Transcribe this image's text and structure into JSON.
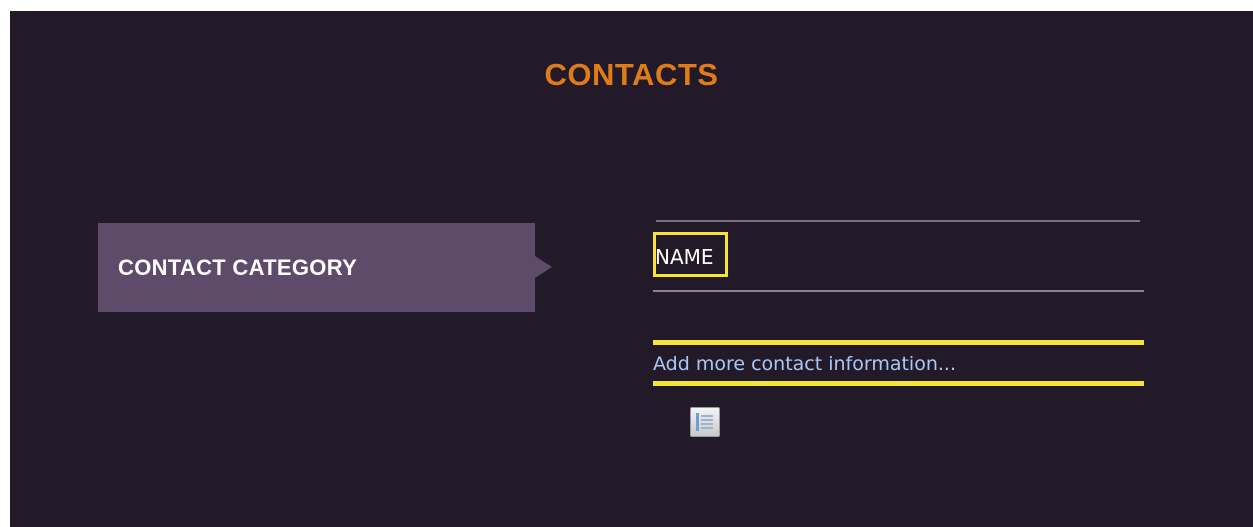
{
  "header": {
    "title": "CONTACTS"
  },
  "category": {
    "label": "CONTACT CATEGORY"
  },
  "form": {
    "name_label": "NAME",
    "add_more_link": "Add more contact information..."
  },
  "icons": {
    "list_icon": "list-icon"
  },
  "colors": {
    "background": "#231a29",
    "title": "#e07b1a",
    "category_panel": "#5e4a69",
    "highlight": "#f5e43a",
    "link": "#a9c8f5"
  }
}
